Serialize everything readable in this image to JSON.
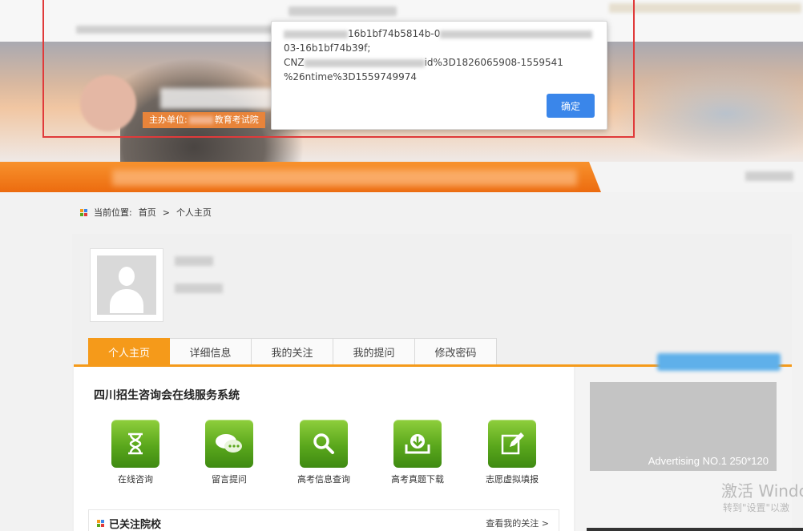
{
  "header": {
    "sponsor_prefix": "主办单位:",
    "sponsor_suffix": "教育考试院"
  },
  "dialog": {
    "line1": "16b1bf74b5814b-0",
    "line2": "03-16b1bf74b39f;",
    "line3_prefix": "CNZ",
    "line3_suffix": "id%3D1826065908-1559541",
    "line4": "%26ntime%3D1559749974",
    "ok_label": "确定"
  },
  "breadcrumb": {
    "prefix": "当前位置:",
    "home": "首页",
    "separator": ">",
    "current": "个人主页"
  },
  "tabs": [
    {
      "label": "个人主页",
      "active": true
    },
    {
      "label": "详细信息",
      "active": false
    },
    {
      "label": "我的关注",
      "active": false
    },
    {
      "label": "我的提问",
      "active": false
    },
    {
      "label": "修改密码",
      "active": false
    }
  ],
  "main": {
    "system_title": "四川招生咨询会在线服务系统",
    "services": [
      {
        "label": "在线咨询",
        "icon": "hourglass-icon"
      },
      {
        "label": "留言提问",
        "icon": "chat-bubbles-icon"
      },
      {
        "label": "高考信息查询",
        "icon": "magnifier-icon"
      },
      {
        "label": "高考真题下载",
        "icon": "download-tray-icon"
      },
      {
        "label": "志愿虚拟填报",
        "icon": "edit-pencil-icon"
      }
    ],
    "followed_title": "已关注院校",
    "followed_link": "查看我的关注 >"
  },
  "sidebar": {
    "ad_text": "Advertising NO.1 250*120"
  },
  "watermark": {
    "line1": "激活 Windc",
    "line2": "转到\"设置\"以激"
  },
  "colors": {
    "accent_orange": "#f59a1a",
    "nav_orange": "#ec6b0f",
    "button_blue": "#3a86ea",
    "service_green": "#5aa71c"
  }
}
